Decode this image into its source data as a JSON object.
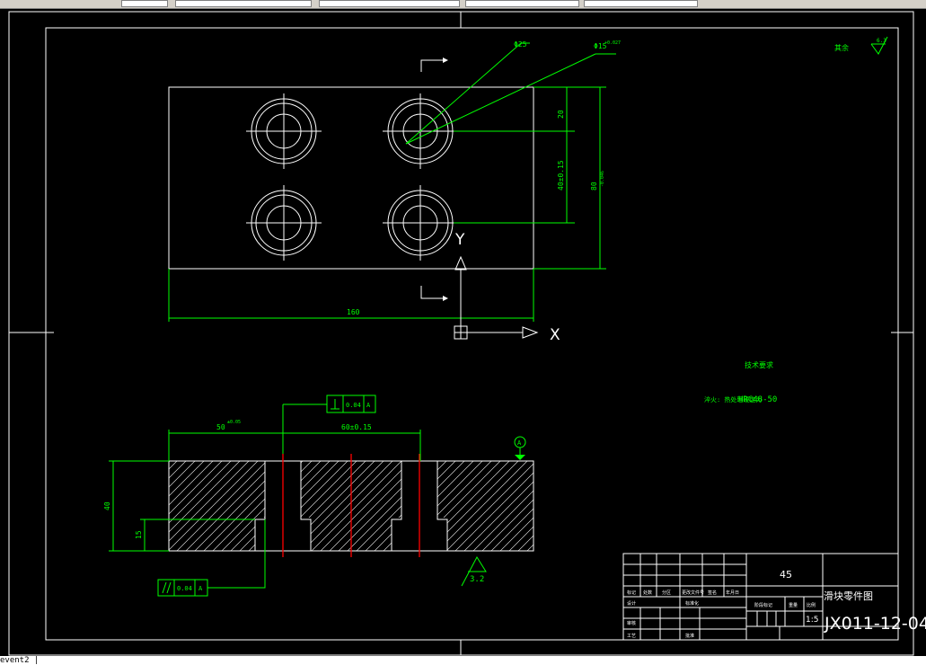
{
  "command_line": "event2 |",
  "dimensions": {
    "hole_dia_25": "Φ25",
    "hole_dia_15": "Φ15",
    "hole_dia_15_tol": "+0.027",
    "y_20": "20",
    "y_40": "40±0.15",
    "y_80": "80",
    "y_80_tol": "-0.046",
    "x_160": "160",
    "x_50": "50",
    "x_50_tol": "±0.05",
    "x_60": "60±0.15",
    "h_40": "40",
    "h_15": "15"
  },
  "tolerances": {
    "perp_value": "0.04",
    "perp_datum": "A",
    "par_value": "0.04",
    "par_datum": "A",
    "datum_symbol": "A"
  },
  "roughness": {
    "bottom": "3.2",
    "corner_label": "其余",
    "corner": "6.3"
  },
  "axis": {
    "x": "X",
    "y": "Y"
  },
  "notes": {
    "title": "技术要求",
    "line1_prefix": "淬火: 热处理硬度为",
    "line1_value": "HRC48-50"
  },
  "title_block": {
    "material": "45",
    "part_name": "滑块零件图",
    "drawing_number": "JX011-12-04",
    "scale": "1:5",
    "sheet": "4",
    "small_labels": [
      "标记",
      "处数",
      "分区",
      "更改文件号",
      "签名",
      "年月日",
      "设计",
      "标准化",
      "审核",
      "工艺",
      "批准",
      "阶段标记",
      "重量",
      "比例"
    ]
  }
}
